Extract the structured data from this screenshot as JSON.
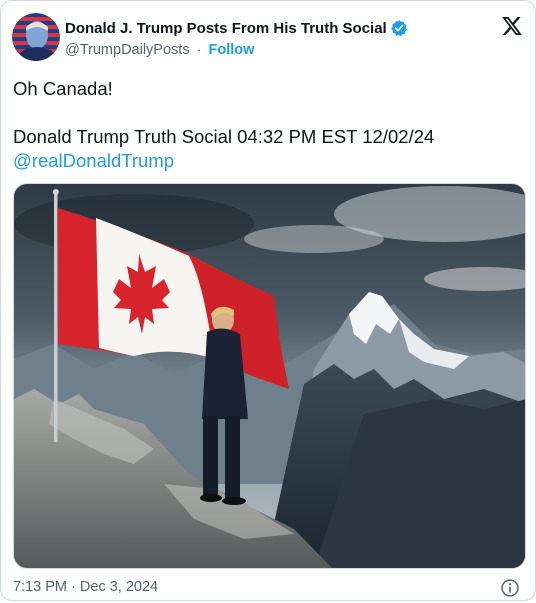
{
  "author": {
    "display_name": "Donald J. Trump Posts From His Truth Social",
    "handle": "@TrumpDailyPosts",
    "separator": "·",
    "follow_label": "Follow",
    "verified": true
  },
  "brand": {
    "logo_icon": "x-logo-icon"
  },
  "tweet": {
    "line_1": "Oh Canada!",
    "line_2": "Donald Trump Truth Social 04:32 PM EST 12/02/24",
    "mention": "@realDonaldTrump"
  },
  "footer": {
    "time": "7:13 PM",
    "separator": "·",
    "date": "Dec 3, 2024",
    "info_icon": "info-icon"
  },
  "colors": {
    "link_blue": "#1d9bf0",
    "secondary_text": "#536471",
    "primary_text": "#0f1419",
    "border": "#cfd9de"
  }
}
